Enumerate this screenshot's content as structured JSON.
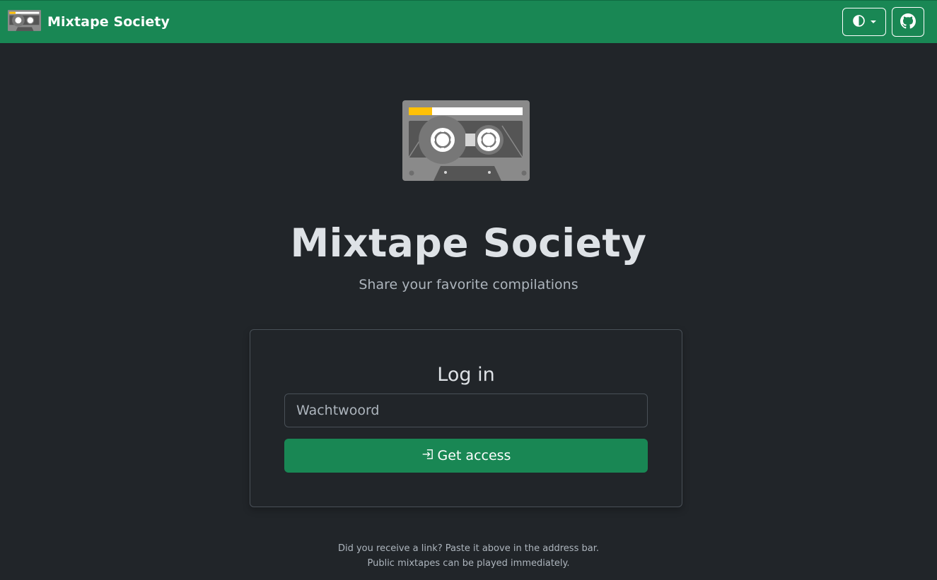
{
  "navbar": {
    "brand_title": "Mixtape Society",
    "brand_icon": "cassette-icon",
    "theme_toggle_icon": "half-circle-icon",
    "github_icon": "github-icon"
  },
  "hero": {
    "logo_icon": "cassette-icon",
    "title": "Mixtape Society",
    "subtitle": "Share your favorite compilations"
  },
  "login": {
    "heading": "Log in",
    "password_placeholder": "Wachtwoord",
    "submit_icon": "login-arrow-icon",
    "submit_label": "Get access"
  },
  "footer": {
    "line1": "Did you receive a link? Paste it above in the address bar.",
    "line2": "Public mixtapes can be played immediately."
  },
  "colors": {
    "brand_green": "#198754",
    "background": "#212529",
    "text": "#dee2e6",
    "muted_text": "#adb5bd",
    "accent_yellow": "#ffc107"
  }
}
